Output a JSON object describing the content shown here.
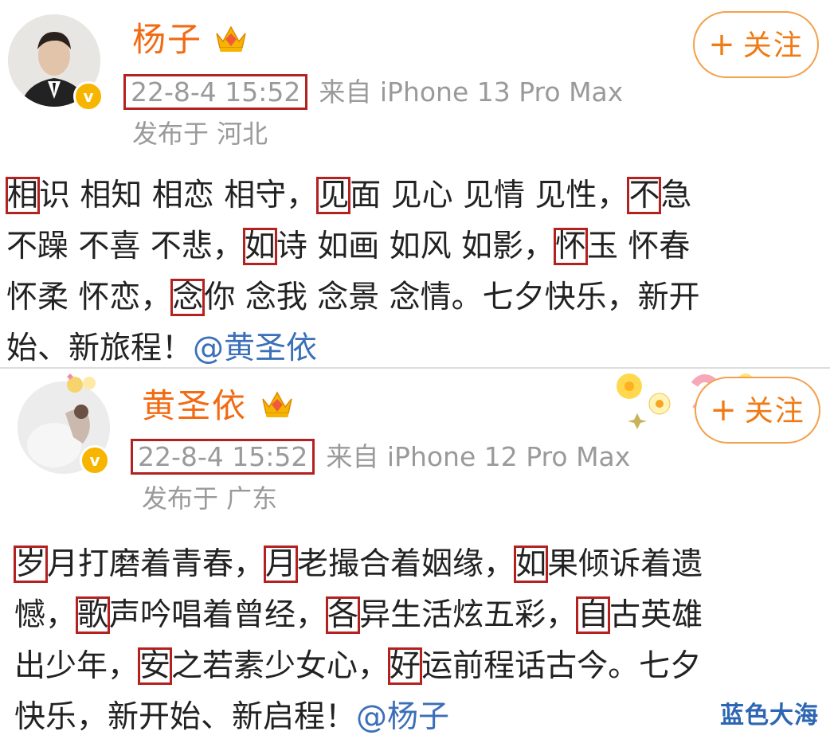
{
  "posts": [
    {
      "author": "杨子",
      "time": "22-8-4 15:52",
      "source": "来自 iPhone 13 Pro Max",
      "location": "发布于 河北",
      "follow_label": "关注",
      "verified_mark": "v",
      "lines": [
        [
          {
            "t": "相",
            "h": true
          },
          {
            "t": "识 相知 相恋 相守，"
          },
          {
            "t": "见",
            "h": true
          },
          {
            "t": "面 见心 见情 见性，"
          },
          {
            "t": "不",
            "h": true
          },
          {
            "t": "急"
          }
        ],
        [
          {
            "t": "不躁 不喜 不悲，"
          },
          {
            "t": "如",
            "h": true
          },
          {
            "t": "诗 如画 如风 如影，"
          },
          {
            "t": "怀",
            "h": true
          },
          {
            "t": "玉 怀春"
          }
        ],
        [
          {
            "t": "怀柔 怀恋，"
          },
          {
            "t": "念",
            "h": true
          },
          {
            "t": "你 念我 念景 念情。七夕快乐，新开"
          }
        ],
        [
          {
            "t": "始、新旅程！"
          },
          {
            "t": "@黄圣依",
            "m": true
          }
        ]
      ]
    },
    {
      "author": "黄圣依",
      "time": "22-8-4 15:52",
      "source": "来自 iPhone 12 Pro Max",
      "location": "发布于 广东",
      "follow_label": "关注",
      "verified_mark": "v",
      "lines": [
        [
          {
            "t": "岁",
            "h": true
          },
          {
            "t": "月打磨着青春，"
          },
          {
            "t": "月",
            "h": true
          },
          {
            "t": "老撮合着姻缘，"
          },
          {
            "t": "如",
            "h": true
          },
          {
            "t": "果倾诉着遗"
          }
        ],
        [
          {
            "t": "憾，"
          },
          {
            "t": "歌",
            "h": true
          },
          {
            "t": "声吟唱着曾经，"
          },
          {
            "t": "各",
            "h": true
          },
          {
            "t": "异生活炫五彩，"
          },
          {
            "t": "自",
            "h": true
          },
          {
            "t": "古英雄"
          }
        ],
        [
          {
            "t": "出少年，"
          },
          {
            "t": "安",
            "h": true
          },
          {
            "t": "之若素少女心，"
          },
          {
            "t": "好",
            "h": true
          },
          {
            "t": "运前程话古今。七夕"
          }
        ],
        [
          {
            "t": "快乐，新开始、新启程！"
          },
          {
            "t": "@杨子",
            "m": true
          }
        ]
      ]
    }
  ],
  "watermark": "蓝色大海",
  "icons": {
    "crown": "crown-vip-icon",
    "verified": "verified-badge-icon",
    "plus": "plus-icon"
  },
  "colors": {
    "name": "#f26a12",
    "highlight_box": "#b32121",
    "mention": "#3b6fb8",
    "meta": "#9a9a9a",
    "follow_border": "#f3a04a"
  }
}
